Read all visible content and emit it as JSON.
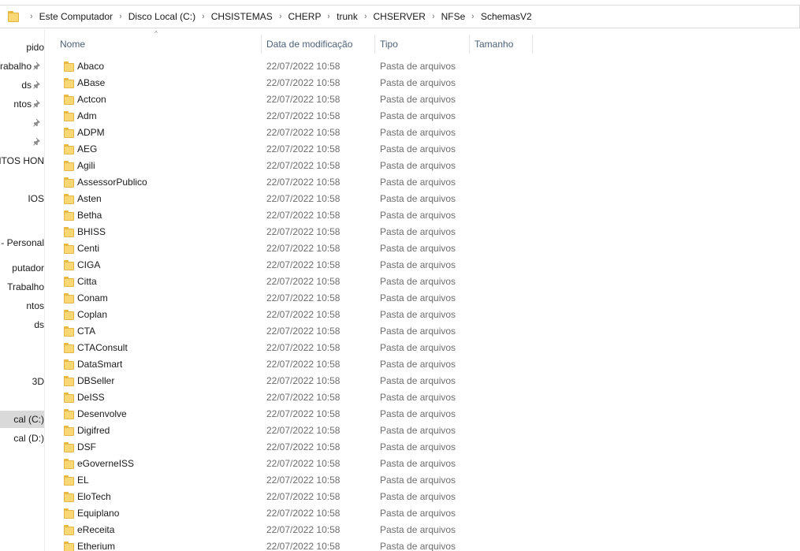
{
  "breadcrumb": [
    "Este Computador",
    "Disco Local (C:)",
    "CHSISTEMAS",
    "CHERP",
    "trunk",
    "CHSERVER",
    "NFSe",
    "SchemasV2"
  ],
  "breadcrumb_separator": "›",
  "nav": [
    {
      "label": "pido",
      "pinned": false
    },
    {
      "label": "Trabalho",
      "pinned": true
    },
    {
      "label": "ds",
      "pinned": true
    },
    {
      "label": "ntos",
      "pinned": true
    },
    {
      "label": "",
      "pinned": true
    },
    {
      "label": "",
      "pinned": true
    },
    {
      "label": "ENTOS HON",
      "pinned": false
    },
    {
      "label": "",
      "pinned": false
    },
    {
      "label": "IOS",
      "pinned": false
    },
    {
      "label": "",
      "pinned": false
    },
    {
      "label": "- Personal",
      "pinned": false
    },
    {
      "label": "putador",
      "pinned": false
    },
    {
      "label": "Trabalho",
      "pinned": false
    },
    {
      "label": "ntos",
      "pinned": false
    },
    {
      "label": "ds",
      "pinned": false
    },
    {
      "label": "",
      "pinned": false
    },
    {
      "label": "",
      "pinned": false
    },
    {
      "label": "3D",
      "pinned": false
    },
    {
      "label": "",
      "pinned": false
    },
    {
      "label": "cal (C:)",
      "pinned": false,
      "selected": true
    },
    {
      "label": "cal (D:)",
      "pinned": false
    }
  ],
  "columns": {
    "name": "Nome",
    "date": "Data de modificação",
    "type": "Tipo",
    "size": "Tamanho",
    "sort_indicator": "^"
  },
  "files": [
    {
      "name": "Abaco",
      "date": "22/07/2022 10:58",
      "type": "Pasta de arquivos"
    },
    {
      "name": "ABase",
      "date": "22/07/2022 10:58",
      "type": "Pasta de arquivos"
    },
    {
      "name": "Actcon",
      "date": "22/07/2022 10:58",
      "type": "Pasta de arquivos"
    },
    {
      "name": "Adm",
      "date": "22/07/2022 10:58",
      "type": "Pasta de arquivos"
    },
    {
      "name": "ADPM",
      "date": "22/07/2022 10:58",
      "type": "Pasta de arquivos"
    },
    {
      "name": "AEG",
      "date": "22/07/2022 10:58",
      "type": "Pasta de arquivos"
    },
    {
      "name": "Agili",
      "date": "22/07/2022 10:58",
      "type": "Pasta de arquivos"
    },
    {
      "name": "AssessorPublico",
      "date": "22/07/2022 10:58",
      "type": "Pasta de arquivos"
    },
    {
      "name": "Asten",
      "date": "22/07/2022 10:58",
      "type": "Pasta de arquivos"
    },
    {
      "name": "Betha",
      "date": "22/07/2022 10:58",
      "type": "Pasta de arquivos"
    },
    {
      "name": "BHISS",
      "date": "22/07/2022 10:58",
      "type": "Pasta de arquivos"
    },
    {
      "name": "Centi",
      "date": "22/07/2022 10:58",
      "type": "Pasta de arquivos"
    },
    {
      "name": "CIGA",
      "date": "22/07/2022 10:58",
      "type": "Pasta de arquivos"
    },
    {
      "name": "Citta",
      "date": "22/07/2022 10:58",
      "type": "Pasta de arquivos"
    },
    {
      "name": "Conam",
      "date": "22/07/2022 10:58",
      "type": "Pasta de arquivos"
    },
    {
      "name": "Coplan",
      "date": "22/07/2022 10:58",
      "type": "Pasta de arquivos"
    },
    {
      "name": "CTA",
      "date": "22/07/2022 10:58",
      "type": "Pasta de arquivos"
    },
    {
      "name": "CTAConsult",
      "date": "22/07/2022 10:58",
      "type": "Pasta de arquivos"
    },
    {
      "name": "DataSmart",
      "date": "22/07/2022 10:58",
      "type": "Pasta de arquivos"
    },
    {
      "name": "DBSeller",
      "date": "22/07/2022 10:58",
      "type": "Pasta de arquivos"
    },
    {
      "name": "DeISS",
      "date": "22/07/2022 10:58",
      "type": "Pasta de arquivos"
    },
    {
      "name": "Desenvolve",
      "date": "22/07/2022 10:58",
      "type": "Pasta de arquivos"
    },
    {
      "name": "Digifred",
      "date": "22/07/2022 10:58",
      "type": "Pasta de arquivos"
    },
    {
      "name": "DSF",
      "date": "22/07/2022 10:58",
      "type": "Pasta de arquivos"
    },
    {
      "name": "eGoverneISS",
      "date": "22/07/2022 10:58",
      "type": "Pasta de arquivos"
    },
    {
      "name": "EL",
      "date": "22/07/2022 10:58",
      "type": "Pasta de arquivos"
    },
    {
      "name": "EloTech",
      "date": "22/07/2022 10:58",
      "type": "Pasta de arquivos"
    },
    {
      "name": "Equiplano",
      "date": "22/07/2022 10:58",
      "type": "Pasta de arquivos"
    },
    {
      "name": "eReceita",
      "date": "22/07/2022 10:58",
      "type": "Pasta de arquivos"
    },
    {
      "name": "Etherium",
      "date": "22/07/2022 10:58",
      "type": "Pasta de arquivos"
    }
  ]
}
